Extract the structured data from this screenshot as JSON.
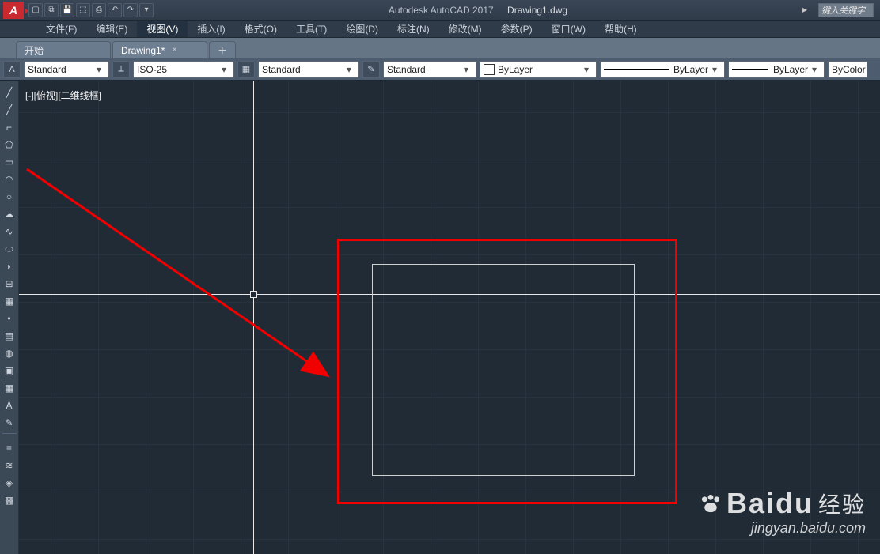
{
  "title": {
    "app": "Autodesk AutoCAD 2017",
    "file": "Drawing1.dwg",
    "search_placeholder": "键入关键字"
  },
  "logo": "A",
  "qat_icons": [
    "new",
    "open",
    "save",
    "saveall",
    "print",
    "undo",
    "redo",
    "down"
  ],
  "menu": [
    {
      "label": "文件(F)"
    },
    {
      "label": "编辑(E)"
    },
    {
      "label": "视图(V)",
      "active": true
    },
    {
      "label": "插入(I)"
    },
    {
      "label": "格式(O)"
    },
    {
      "label": "工具(T)"
    },
    {
      "label": "绘图(D)"
    },
    {
      "label": "标注(N)"
    },
    {
      "label": "修改(M)"
    },
    {
      "label": "参数(P)"
    },
    {
      "label": "窗口(W)"
    },
    {
      "label": "帮助(H)"
    }
  ],
  "tabs": [
    {
      "label": "开始",
      "active": false,
      "closable": false
    },
    {
      "label": "Drawing1*",
      "active": true,
      "closable": true
    }
  ],
  "propbar": {
    "text_style": "Standard",
    "dim_style": "ISO-25",
    "table_style": "Standard",
    "ml_style": "Standard",
    "layer": "ByLayer",
    "ltype": "ByLayer",
    "lweight": "ByLayer",
    "color": "ByColor"
  },
  "view_label": "[-][俯视][二维线框]",
  "left_tools": [
    {
      "name": "line-tool",
      "glyph": "╱"
    },
    {
      "name": "xline-tool",
      "glyph": "╱"
    },
    {
      "name": "polyline-tool",
      "glyph": "⌐"
    },
    {
      "name": "polygon-tool",
      "glyph": "⬠"
    },
    {
      "name": "rectangle-tool",
      "glyph": "▭",
      "highlight": true
    },
    {
      "name": "arc-tool",
      "glyph": "◠"
    },
    {
      "name": "circle-tool",
      "glyph": "○"
    },
    {
      "name": "revcloud-tool",
      "glyph": "☁"
    },
    {
      "name": "spline-tool",
      "glyph": "∿"
    },
    {
      "name": "ellipse-tool",
      "glyph": "⬭"
    },
    {
      "name": "ellipsearc-tool",
      "glyph": "◗"
    },
    {
      "name": "insert-tool",
      "glyph": "⊞"
    },
    {
      "name": "block-tool",
      "glyph": "▦"
    },
    {
      "name": "point-tool",
      "glyph": "•"
    },
    {
      "name": "hatch-tool",
      "glyph": "▤"
    },
    {
      "name": "gradient-tool",
      "glyph": "◍"
    },
    {
      "name": "region-tool",
      "glyph": "▣"
    },
    {
      "name": "table-tool",
      "glyph": "▦"
    },
    {
      "name": "text-tool",
      "glyph": "A"
    },
    {
      "name": "addsel-tool",
      "glyph": "✎"
    }
  ],
  "left_tools2": [
    {
      "name": "measure-tool",
      "glyph": "≡"
    },
    {
      "name": "inquiry-tool",
      "glyph": "≋"
    },
    {
      "name": "quicksel-tool",
      "glyph": "◈"
    },
    {
      "name": "select-tool",
      "glyph": "▩"
    }
  ],
  "watermark": {
    "brand": "Baidu",
    "cn": "经验",
    "url": "jingyan.baidu.com"
  }
}
